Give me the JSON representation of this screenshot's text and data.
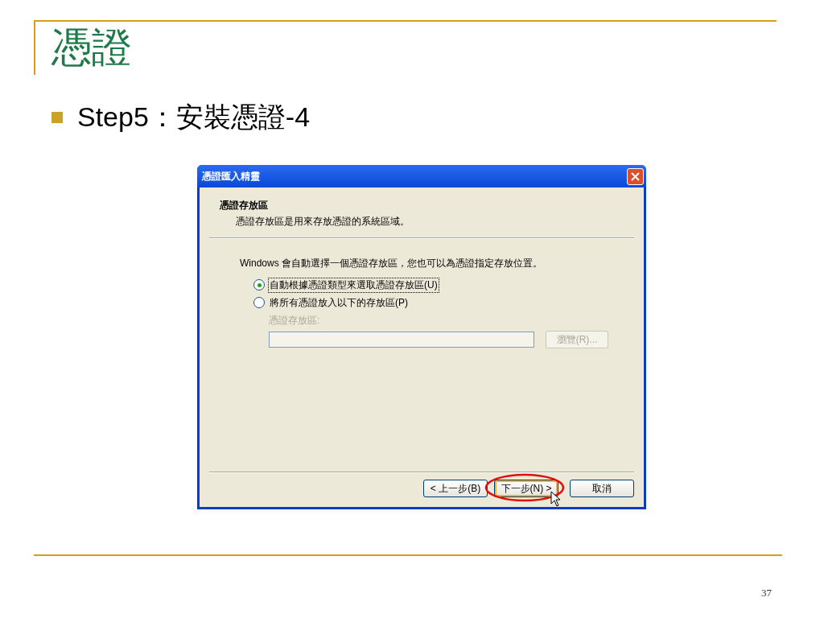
{
  "slide": {
    "title": "憑證",
    "bullet": "Step5：安裝憑證-4",
    "page_number": "37"
  },
  "dialog": {
    "title": "憑證匯入精靈",
    "header_title": "憑證存放區",
    "header_subtitle": "憑證存放區是用來存放憑證的系統區域。",
    "intro": "Windows 會自動選擇一個憑證存放區，您也可以為憑證指定存放位置。",
    "options": [
      {
        "label": "自動根據憑證類型來選取憑證存放區(U)",
        "selected": true
      },
      {
        "label": "將所有憑證放入以下的存放區(P)",
        "selected": false
      }
    ],
    "store": {
      "label": "憑證存放區:",
      "browse": "瀏覽(R)...",
      "disabled": true
    },
    "buttons": [
      {
        "label": "< 上一步(B)",
        "focused": false,
        "circled": false
      },
      {
        "label": "下一步(N) >",
        "focused": true,
        "circled": true
      },
      {
        "label": "取消",
        "focused": false,
        "circled": false
      }
    ]
  }
}
